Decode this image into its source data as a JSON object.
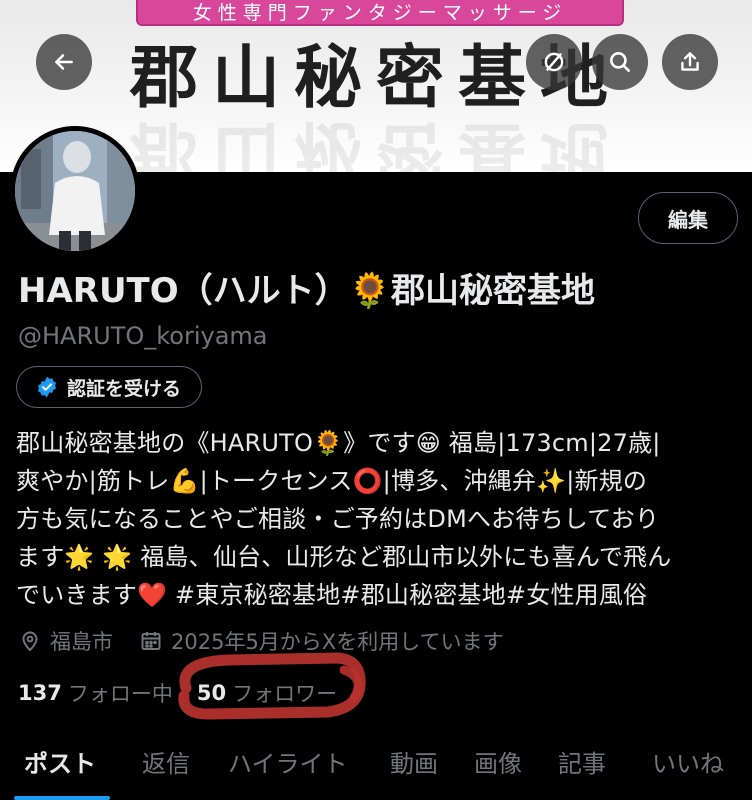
{
  "banner": {
    "pill_text": "女性専門ファンタジーマッサージ",
    "title": "郡山秘密基地"
  },
  "header": {
    "back_icon": "arrow-left-icon",
    "mute_icon": "mute-circle-icon",
    "search_icon": "search-icon",
    "share_icon": "share-icon"
  },
  "profile": {
    "edit_label": "編集",
    "name_part1": "HARUTO（ハルト）",
    "name_emoji": "🌻",
    "name_part2": "郡山秘密基地",
    "handle": "@HARUTO_koriyama",
    "verify_label": "認証を受ける",
    "bio_lines": [
      "郡山秘密基地の《HARUTO🌻》です😁 福島|173cm|27歳|",
      "爽やか|筋トレ💪|トークセンス⭕|博多、沖縄弁✨|新規の",
      "方も気になることやご相談・ご予約はDMへお待ちしており",
      "ます🌟 🌟 福島、仙台、山形など郡山市以外にも喜んで飛ん",
      "でいきます❤️ #東京秘密基地#郡山秘密基地#女性用風俗"
    ],
    "location": "福島市",
    "joined": "2025年5月からXを利用しています",
    "following_count": "137",
    "following_label": "フォロー中",
    "followers_count": "50",
    "followers_label": "フォロワー"
  },
  "tabs": [
    {
      "label": "ポスト",
      "active": true
    },
    {
      "label": "返信",
      "active": false
    },
    {
      "label": "ハイライト",
      "active": false
    },
    {
      "label": "動画",
      "active": false
    },
    {
      "label": "画像",
      "active": false
    },
    {
      "label": "記事",
      "active": false
    },
    {
      "label": "いいね",
      "active": false
    }
  ],
  "colors": {
    "accent": "#1d9bf0",
    "muted": "#71767b",
    "banner_pill": "#d8479a",
    "scribble": "#b8322e"
  }
}
